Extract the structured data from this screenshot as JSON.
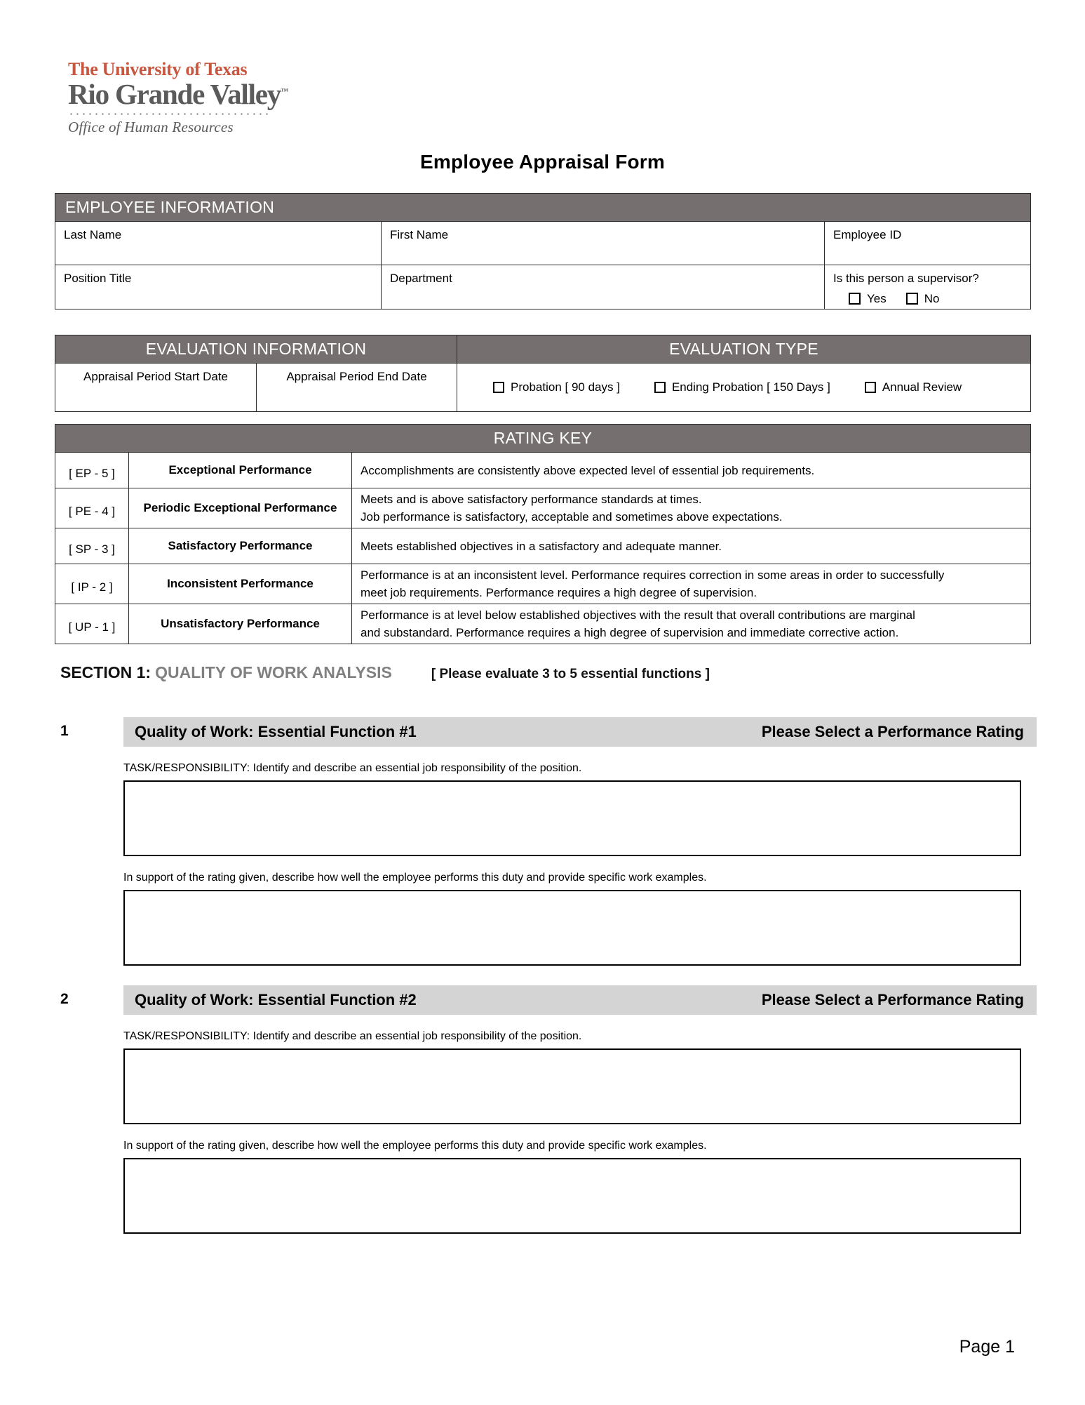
{
  "logo": {
    "line1": "The University of Texas",
    "line2": "Rio Grande Valley",
    "tm": "™",
    "line3": "Office of Human Resources",
    "accent_color": "#c8553d",
    "gray_color": "#5b5b5b"
  },
  "title": "Employee Appraisal Form",
  "colors": {
    "header_dark": "#75706f",
    "bar_light": "#d4d4d4",
    "section_gray_text": "#808080"
  },
  "employee_information": {
    "header": "EMPLOYEE INFORMATION",
    "fields": {
      "last_name": "Last Name",
      "first_name": "First Name",
      "employee_id": "Employee ID",
      "position_title": "Position Title",
      "department": "Department",
      "supervisor_question": "Is this person a supervisor?",
      "supervisor_yes": "Yes",
      "supervisor_no": "No"
    }
  },
  "evaluation": {
    "info_header": "EVALUATION INFORMATION",
    "type_header": "EVALUATION TYPE",
    "start_date_label": "Appraisal Period Start Date",
    "end_date_label": "Appraisal Period End Date",
    "types": [
      "Probation [ 90 days ]",
      "Ending Probation [ 150 Days ]",
      "Annual Review"
    ]
  },
  "rating_key": {
    "header": "RATING KEY",
    "rows": [
      {
        "code": "[ EP - 5 ]",
        "name": "Exceptional Performance",
        "description": [
          "Accomplishments are consistently above expected level of essential job requirements."
        ]
      },
      {
        "code": "[ PE - 4 ]",
        "name": "Periodic Exceptional Performance",
        "description": [
          "Meets and is above satisfactory performance standards at times.",
          "Job performance is satisfactory, acceptable and sometimes above expectations."
        ]
      },
      {
        "code": "[ SP - 3 ]",
        "name": "Satisfactory Performance",
        "description": [
          "Meets established objectives in a satisfactory and adequate manner."
        ]
      },
      {
        "code": "[ IP - 2 ]",
        "name": "Inconsistent Performance",
        "description": [
          "Performance is at an inconsistent level. Performance requires correction in some areas in order to successfully",
          "meet job requirements. Performance requires a high degree of supervision."
        ]
      },
      {
        "code": "[ UP - 1 ]",
        "name": "Unsatisfactory Performance",
        "description": [
          "Performance is at level below established objectives with the result that overall contributions are marginal",
          "and substandard. Performance requires a high degree of supervision and immediate corrective action."
        ]
      }
    ]
  },
  "section1": {
    "label": "SECTION 1",
    "separator": ":",
    "title": "QUALITY OF WORK ANALYSIS",
    "note": "[ Please evaluate 3 to 5 essential functions ]",
    "functions": [
      {
        "index": "1",
        "bar_title": "Quality of Work: Essential Function #1",
        "bar_rating": "Please Select a Performance Rating",
        "task_prompt": "TASK/RESPONSIBILITY: Identify and describe an essential job responsibility of the position.",
        "task_value": "",
        "support_prompt": "In support of the rating given, describe how well the employee performs this duty and provide specific work examples.",
        "support_value": ""
      },
      {
        "index": "2",
        "bar_title": "Quality of Work: Essential Function #2",
        "bar_rating": "Please Select a Performance Rating",
        "task_prompt": "TASK/RESPONSIBILITY: Identify and describe an essential job responsibility of the position.",
        "task_value": "",
        "support_prompt": "In support of the rating given, describe how well the employee performs this duty and provide specific work examples.",
        "support_value": ""
      }
    ]
  },
  "footer": {
    "page": "Page 1"
  }
}
